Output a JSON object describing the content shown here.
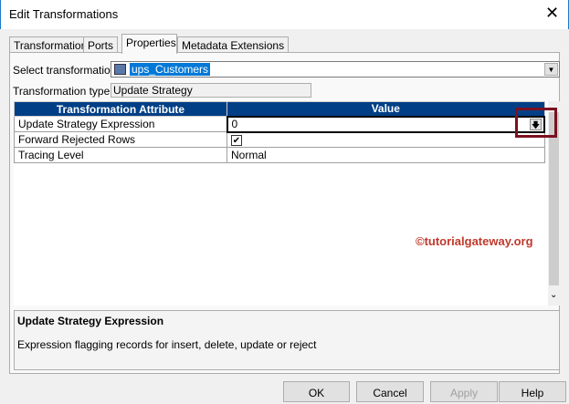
{
  "window": {
    "title": "Edit Transformations",
    "close": "✕"
  },
  "tabs": [
    "Transformation",
    "Ports",
    "Properties",
    "Metadata Extensions"
  ],
  "select": {
    "label": "Select transformation:",
    "value": "ups_Customers"
  },
  "type": {
    "label": "Transformation type:",
    "value": "Update Strategy"
  },
  "grid": {
    "headers": [
      "Transformation Attribute",
      "Value"
    ],
    "rows": [
      {
        "attr": "Update Strategy Expression",
        "value": "0"
      },
      {
        "attr": "Forward Rejected Rows",
        "value": "✔"
      },
      {
        "attr": "Tracing Level",
        "value": "Normal"
      }
    ]
  },
  "description": {
    "title": "Update Strategy Expression",
    "text": "Expression flagging records for insert, delete, update or reject"
  },
  "watermark": "©tutorialgateway.org",
  "buttons": {
    "ok": "OK",
    "cancel": "Cancel",
    "apply": "Apply",
    "help": "Help"
  }
}
